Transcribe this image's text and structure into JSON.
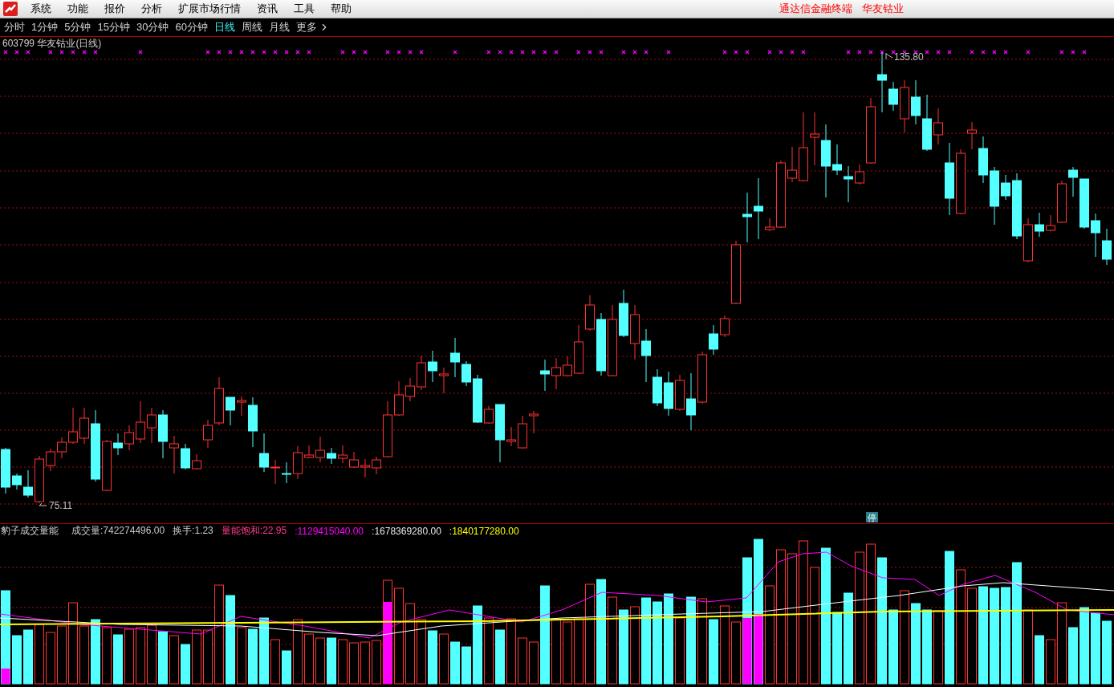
{
  "menu": {
    "items": [
      "系统",
      "功能",
      "报价",
      "分析",
      "扩展市场行情",
      "资讯",
      "工具",
      "帮助"
    ],
    "right_texts": [
      "通达信金融终端",
      "华友钴业"
    ]
  },
  "periods": [
    {
      "label": "分时",
      "selected": false
    },
    {
      "label": "1分钟",
      "selected": false
    },
    {
      "label": "5分钟",
      "selected": false
    },
    {
      "label": "15分钟",
      "selected": false
    },
    {
      "label": "30分钟",
      "selected": false
    },
    {
      "label": "60分钟",
      "selected": false
    },
    {
      "label": "日线",
      "selected": true
    },
    {
      "label": "周线",
      "selected": false
    },
    {
      "label": "月线",
      "selected": false
    },
    {
      "label": "更多",
      "selected": false
    }
  ],
  "chart": {
    "title": "603799 华友钴业(日线)",
    "high_label": "135.80",
    "low_label": "75.11",
    "badge": "停"
  },
  "indicator": {
    "name": "豹子成交量能",
    "items": [
      {
        "label": "成交量:",
        "value": "742274496.00",
        "color": "#c8c8c8"
      },
      {
        "label": "换手:",
        "value": "1.23",
        "color": "#c8c8c8"
      },
      {
        "label": "量能饱和:",
        "value": "22.95",
        "color": "#ff3c8c"
      },
      {
        "label": ":",
        "value": "1129415040.00",
        "color": "#ff00ff"
      },
      {
        "label": ":",
        "value": "1678369280.00",
        "color": "#e6e6e6"
      },
      {
        "label": ":",
        "value": "1840177280.00",
        "color": "#ffff00"
      }
    ]
  }
}
